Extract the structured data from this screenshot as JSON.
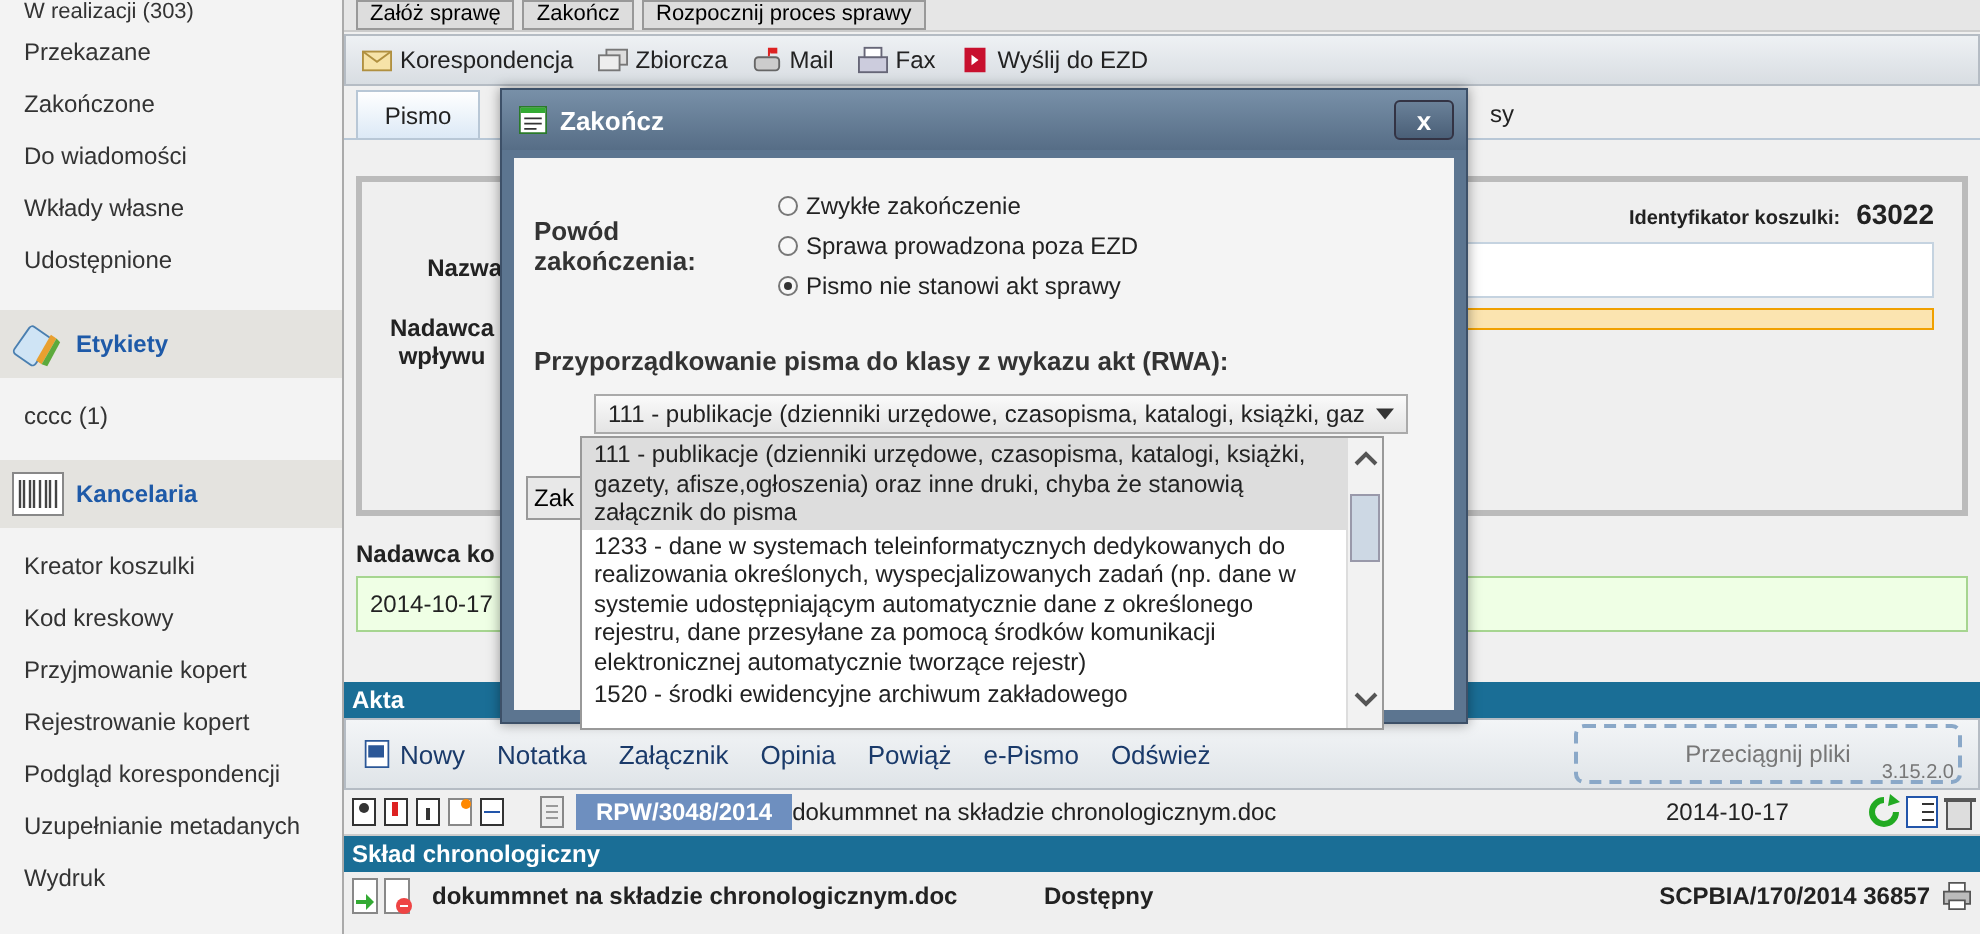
{
  "sidebar": {
    "items_top": [
      {
        "label": "W realizacji (303)"
      },
      {
        "label": "Przekazane"
      },
      {
        "label": "Zakończone"
      },
      {
        "label": "Do wiadomości"
      },
      {
        "label": "Wkłady własne"
      },
      {
        "label": "Udostępnione"
      }
    ],
    "sections": [
      {
        "kind": "tags",
        "title": "Etykiety",
        "items": [
          {
            "label": "cccc (1)"
          }
        ]
      },
      {
        "kind": "barcode",
        "title": "Kancelaria",
        "items": [
          {
            "label": "Kreator koszulki"
          },
          {
            "label": "Kod kreskowy"
          },
          {
            "label": "Przyjmowanie kopert"
          },
          {
            "label": "Rejestrowanie kopert"
          },
          {
            "label": "Podgląd korespondencji"
          },
          {
            "label": "Uzupełnianie metadanych"
          },
          {
            "label": "Wydruk"
          }
        ]
      }
    ]
  },
  "top_toolbar": [
    {
      "label": "Załóż sprawę"
    },
    {
      "label": "Zakończ"
    },
    {
      "label": "Rozpocznij proces sprawy"
    }
  ],
  "toolbar": [
    {
      "kind": "envelope",
      "label": "Korespondencja"
    },
    {
      "kind": "stack",
      "label": "Zbiorcza"
    },
    {
      "kind": "mailbox",
      "label": "Mail"
    },
    {
      "kind": "fax",
      "label": "Fax"
    },
    {
      "kind": "ezd",
      "label": "Wyślij do EZD"
    }
  ],
  "tabs": [
    {
      "label": "Pismo",
      "selected": true
    },
    {
      "label": "sy",
      "selected": false
    }
  ],
  "form": {
    "name_label": "Nazwa",
    "sender_label": "Nadawca wpływu",
    "id_label": "Identyfikator koszulki:",
    "id_value": "63022",
    "sender_header": "Nadawca ko",
    "sender_entry": "2014-10-17"
  },
  "akta": {
    "title": "Akta",
    "toolbar": [
      {
        "label": "Nowy"
      },
      {
        "label": "Notatka"
      },
      {
        "label": "Załącznik"
      },
      {
        "label": "Opinia"
      },
      {
        "label": "Powiąż"
      },
      {
        "label": "e-Pismo"
      },
      {
        "label": "Odśwież"
      }
    ],
    "drop_zone": "Przeciągnij pliki",
    "version": "3.15.2.0",
    "document": {
      "number": "RPW/3048/2014",
      "name": "dokummnet na składzie chronologicznym.doc",
      "date": "2014-10-17"
    }
  },
  "chronological": {
    "title": "Skład chronologiczny",
    "rows": [
      {
        "name": "dokummnet na składzie chronologicznym.doc",
        "status": "Dostępny",
        "signature": "SCPBIA/170/2014 36857"
      }
    ]
  },
  "modal": {
    "title": "Zakończ",
    "close": "x",
    "reason_label": "Powód zakończenia:",
    "reasons": [
      {
        "label": "Zwykłe zakończenie",
        "selected": false
      },
      {
        "label": "Sprawa prowadzona poza EZD",
        "selected": false
      },
      {
        "label": "Pismo nie stanowi akt sprawy",
        "selected": true
      }
    ],
    "rwa_label": "Przyporządkowanie pisma do klasy z wykazu akt (RWA):",
    "rwa_value": "111 - publikacje (dzienniki urzędowe, czasopisma, katalogi, książki, gaz",
    "button": "Zak",
    "options": [
      {
        "label": "111 - publikacje (dzienniki urzędowe, czasopisma, katalogi, książki, gazety, afisze,ogłoszenia) oraz inne druki, chyba że stanowią załącznik do pisma",
        "selected": true
      },
      {
        "label": "1233 - dane w systemach teleinformatycznych dedykowanych do realizowania określonych, wyspecjalizowanych zadań (np. dane w systemie udostępniającym automatycznie dane z określonego rejestru, dane przesyłane za pomocą środków komunikacji elektronicznej automatycznie tworzące rejestr)",
        "selected": false
      },
      {
        "label": "1520 - środki ewidencyjne archiwum zakładowego",
        "selected": false
      }
    ]
  }
}
